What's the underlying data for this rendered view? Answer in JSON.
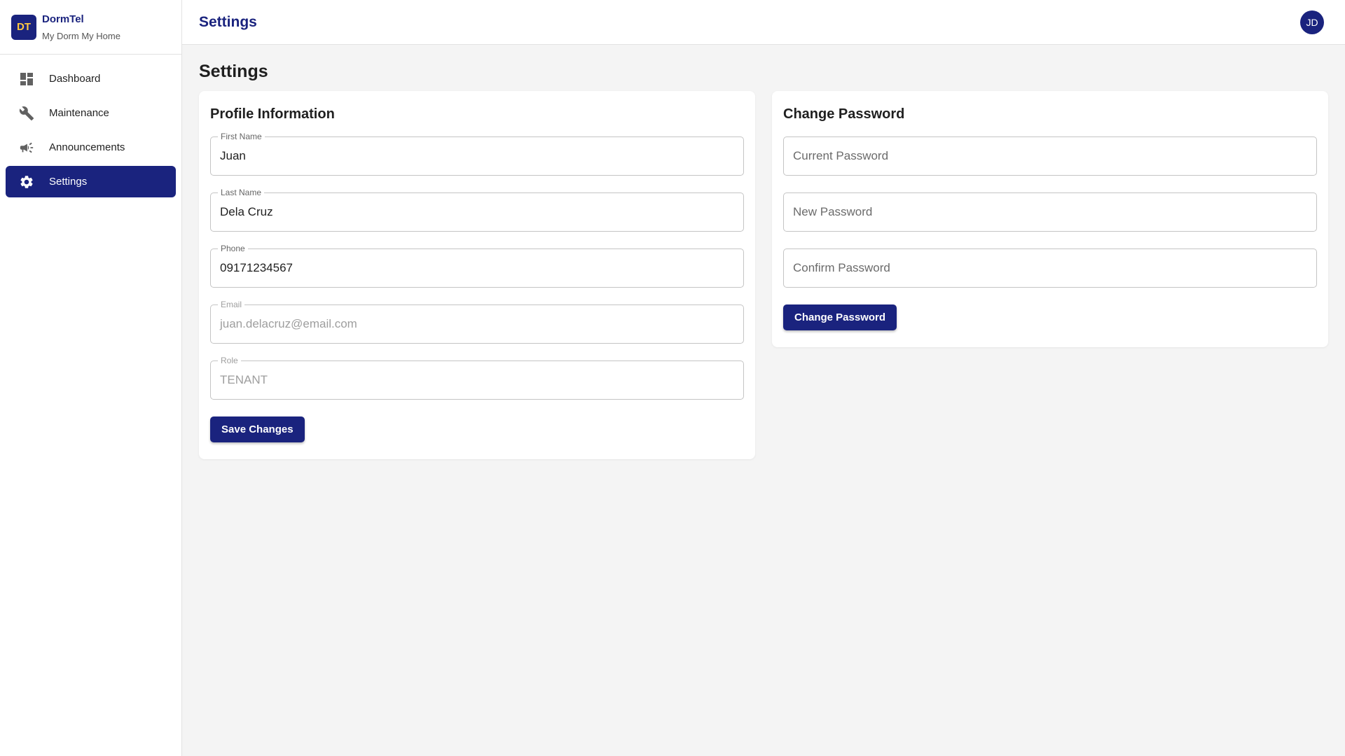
{
  "brand": {
    "logo": "DT",
    "name": "DormTel",
    "tagline": "My Dorm My Home"
  },
  "sidebar": {
    "items": [
      {
        "label": "Dashboard",
        "icon": "dashboard-icon",
        "active": false
      },
      {
        "label": "Maintenance",
        "icon": "wrench-icon",
        "active": false
      },
      {
        "label": "Announcements",
        "icon": "megaphone-icon",
        "active": false
      },
      {
        "label": "Settings",
        "icon": "gear-icon",
        "active": true
      }
    ]
  },
  "header": {
    "title": "Settings",
    "avatar": "JD"
  },
  "main": {
    "title": "Settings",
    "profile": {
      "title": "Profile Information",
      "fields": [
        {
          "label": "First Name",
          "value": "Juan"
        },
        {
          "label": "Last Name",
          "value": "Dela Cruz"
        },
        {
          "label": "Phone",
          "value": "09171234567"
        },
        {
          "label": "Email",
          "value": "juan.delacruz@email.com",
          "disabled": true
        },
        {
          "label": "Role",
          "value": "TENANT",
          "disabled": true
        }
      ],
      "save_label": "Save Changes"
    },
    "password": {
      "title": "Change Password",
      "fields": [
        {
          "placeholder": "Current Password"
        },
        {
          "placeholder": "New Password"
        },
        {
          "placeholder": "Confirm Password"
        }
      ],
      "button_label": "Change Password"
    }
  },
  "colors": {
    "primary": "#1a237e",
    "logo_text": "#ffc940",
    "background": "#f4f4f4"
  }
}
